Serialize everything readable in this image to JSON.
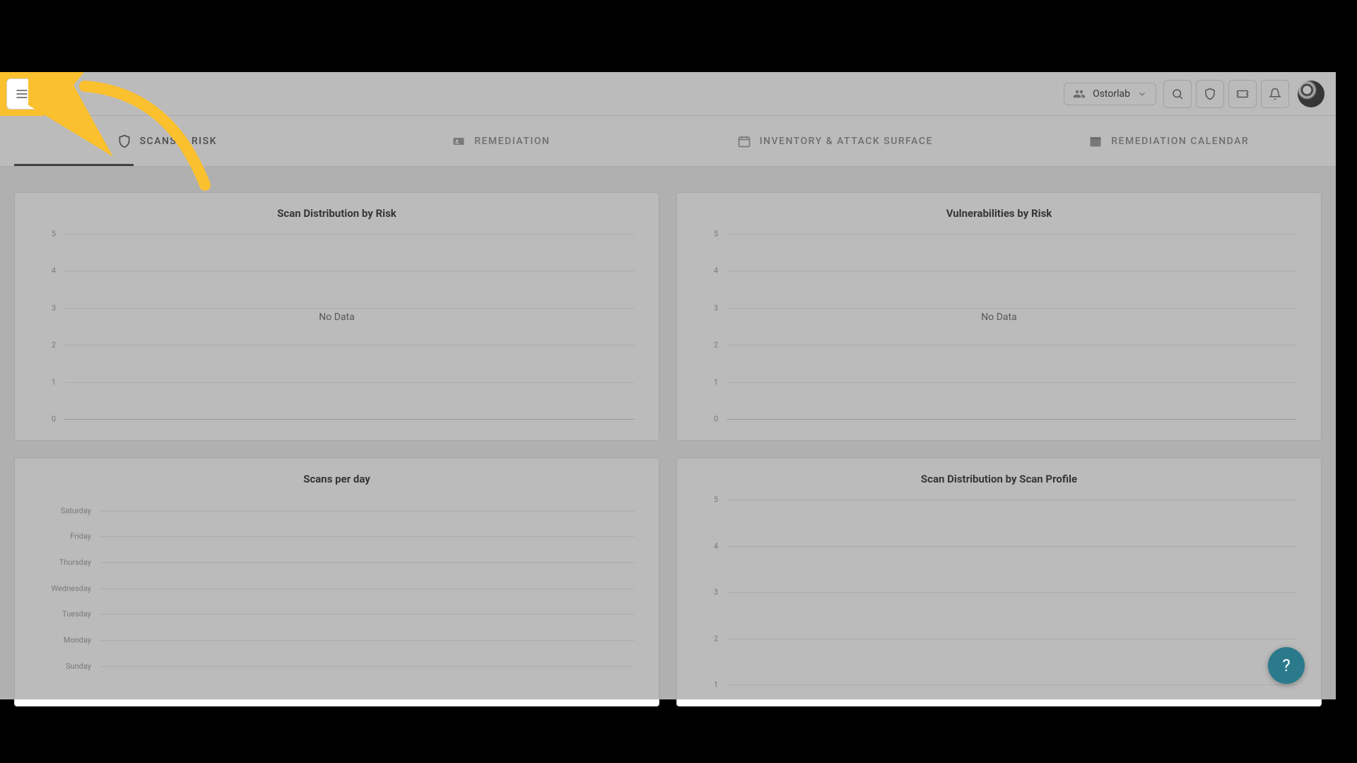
{
  "header": {
    "org_label": "Ostorlab"
  },
  "tabs": [
    {
      "label": "SCANS & RISK",
      "active": true
    },
    {
      "label": "REMEDIATION",
      "active": false
    },
    {
      "label": "INVENTORY & ATTACK SURFACE",
      "active": false
    },
    {
      "label": "REMEDIATION CALENDAR",
      "active": false
    }
  ],
  "cards": {
    "card1": {
      "title": "Scan Distribution by Risk",
      "nodata": "No Data"
    },
    "card2": {
      "title": "Vulnerabilities by Risk",
      "nodata": "No Data"
    },
    "card3": {
      "title": "Scans per day"
    },
    "card4": {
      "title": "Scan Distribution by Scan Profile"
    }
  },
  "chart_data": [
    {
      "id": "scan_distribution_risk",
      "type": "bar",
      "title": "Scan Distribution by Risk",
      "y_ticks": [
        0,
        1,
        2,
        3,
        4,
        5
      ],
      "ylim": [
        0,
        5
      ],
      "categories": [],
      "values": [],
      "annotation": "No Data"
    },
    {
      "id": "vulnerabilities_risk",
      "type": "bar",
      "title": "Vulnerabilities by Risk",
      "y_ticks": [
        0,
        1,
        2,
        3,
        4,
        5
      ],
      "ylim": [
        0,
        5
      ],
      "categories": [],
      "values": [],
      "annotation": "No Data"
    },
    {
      "id": "scans_per_day",
      "type": "bar",
      "title": "Scans per day",
      "orientation": "horizontal",
      "categories": [
        "Saturday",
        "Friday",
        "Thursday",
        "Wednesday",
        "Tuesday",
        "Monday",
        "Sunday"
      ],
      "values": [
        0,
        0,
        0,
        0,
        0,
        0,
        0
      ]
    },
    {
      "id": "scan_distribution_profile",
      "type": "bar",
      "title": "Scan Distribution by Scan Profile",
      "y_ticks": [
        1,
        2,
        3,
        4,
        5
      ],
      "ylim": [
        0,
        5
      ],
      "categories": [],
      "values": []
    }
  ],
  "help_label": "?"
}
